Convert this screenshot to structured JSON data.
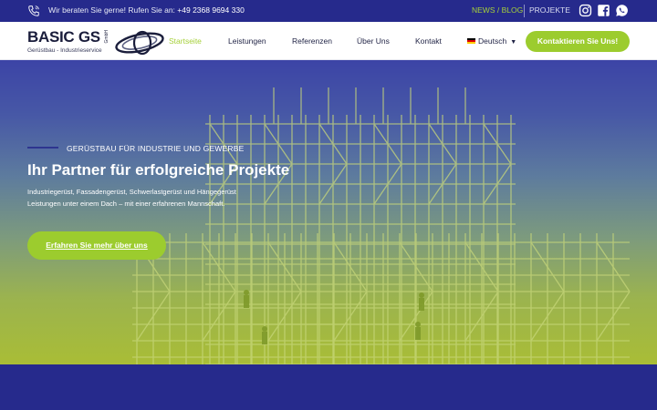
{
  "topbar": {
    "phone_icon": "phone-icon",
    "phone_text": "Wir beraten Sie gerne! Rufen Sie an:",
    "phone_number": "+49 2368 9694 330",
    "news_link": "NEWS / BLOG",
    "projekte_link": "PROJEKTE",
    "social": [
      "instagram-icon",
      "facebook-icon",
      "whatsapp-icon"
    ]
  },
  "logo": {
    "name": "BASIC GS",
    "suffix": "GmbH",
    "subtitle": "Gerüstbau - Industrieservice"
  },
  "nav": {
    "items": [
      "Startseite",
      "Leistungen",
      "Referenzen",
      "Über Uns",
      "Kontakt"
    ],
    "active": "Startseite",
    "language": "Deutsch",
    "cta": "Kontaktieren Sie Uns!"
  },
  "hero": {
    "kicker": "GERÜSTBAU FÜR INDUSTRIE UND GEWERBE",
    "title": "Ihr Partner für erfolgreiche Projekte",
    "desc_line1": "Industriegerüst, Fassadengerüst, Schwerlastgerüst und Hängegerüst",
    "desc_line2": "Leistungen unter einem Dach – mit einer erfahrenen Mannschaft.",
    "button": "Erfahren Sie mehr über uns"
  },
  "colors": {
    "brand_blue": "#262a8c",
    "accent_green": "#9ccc2e",
    "nav_text": "#1f2244"
  }
}
